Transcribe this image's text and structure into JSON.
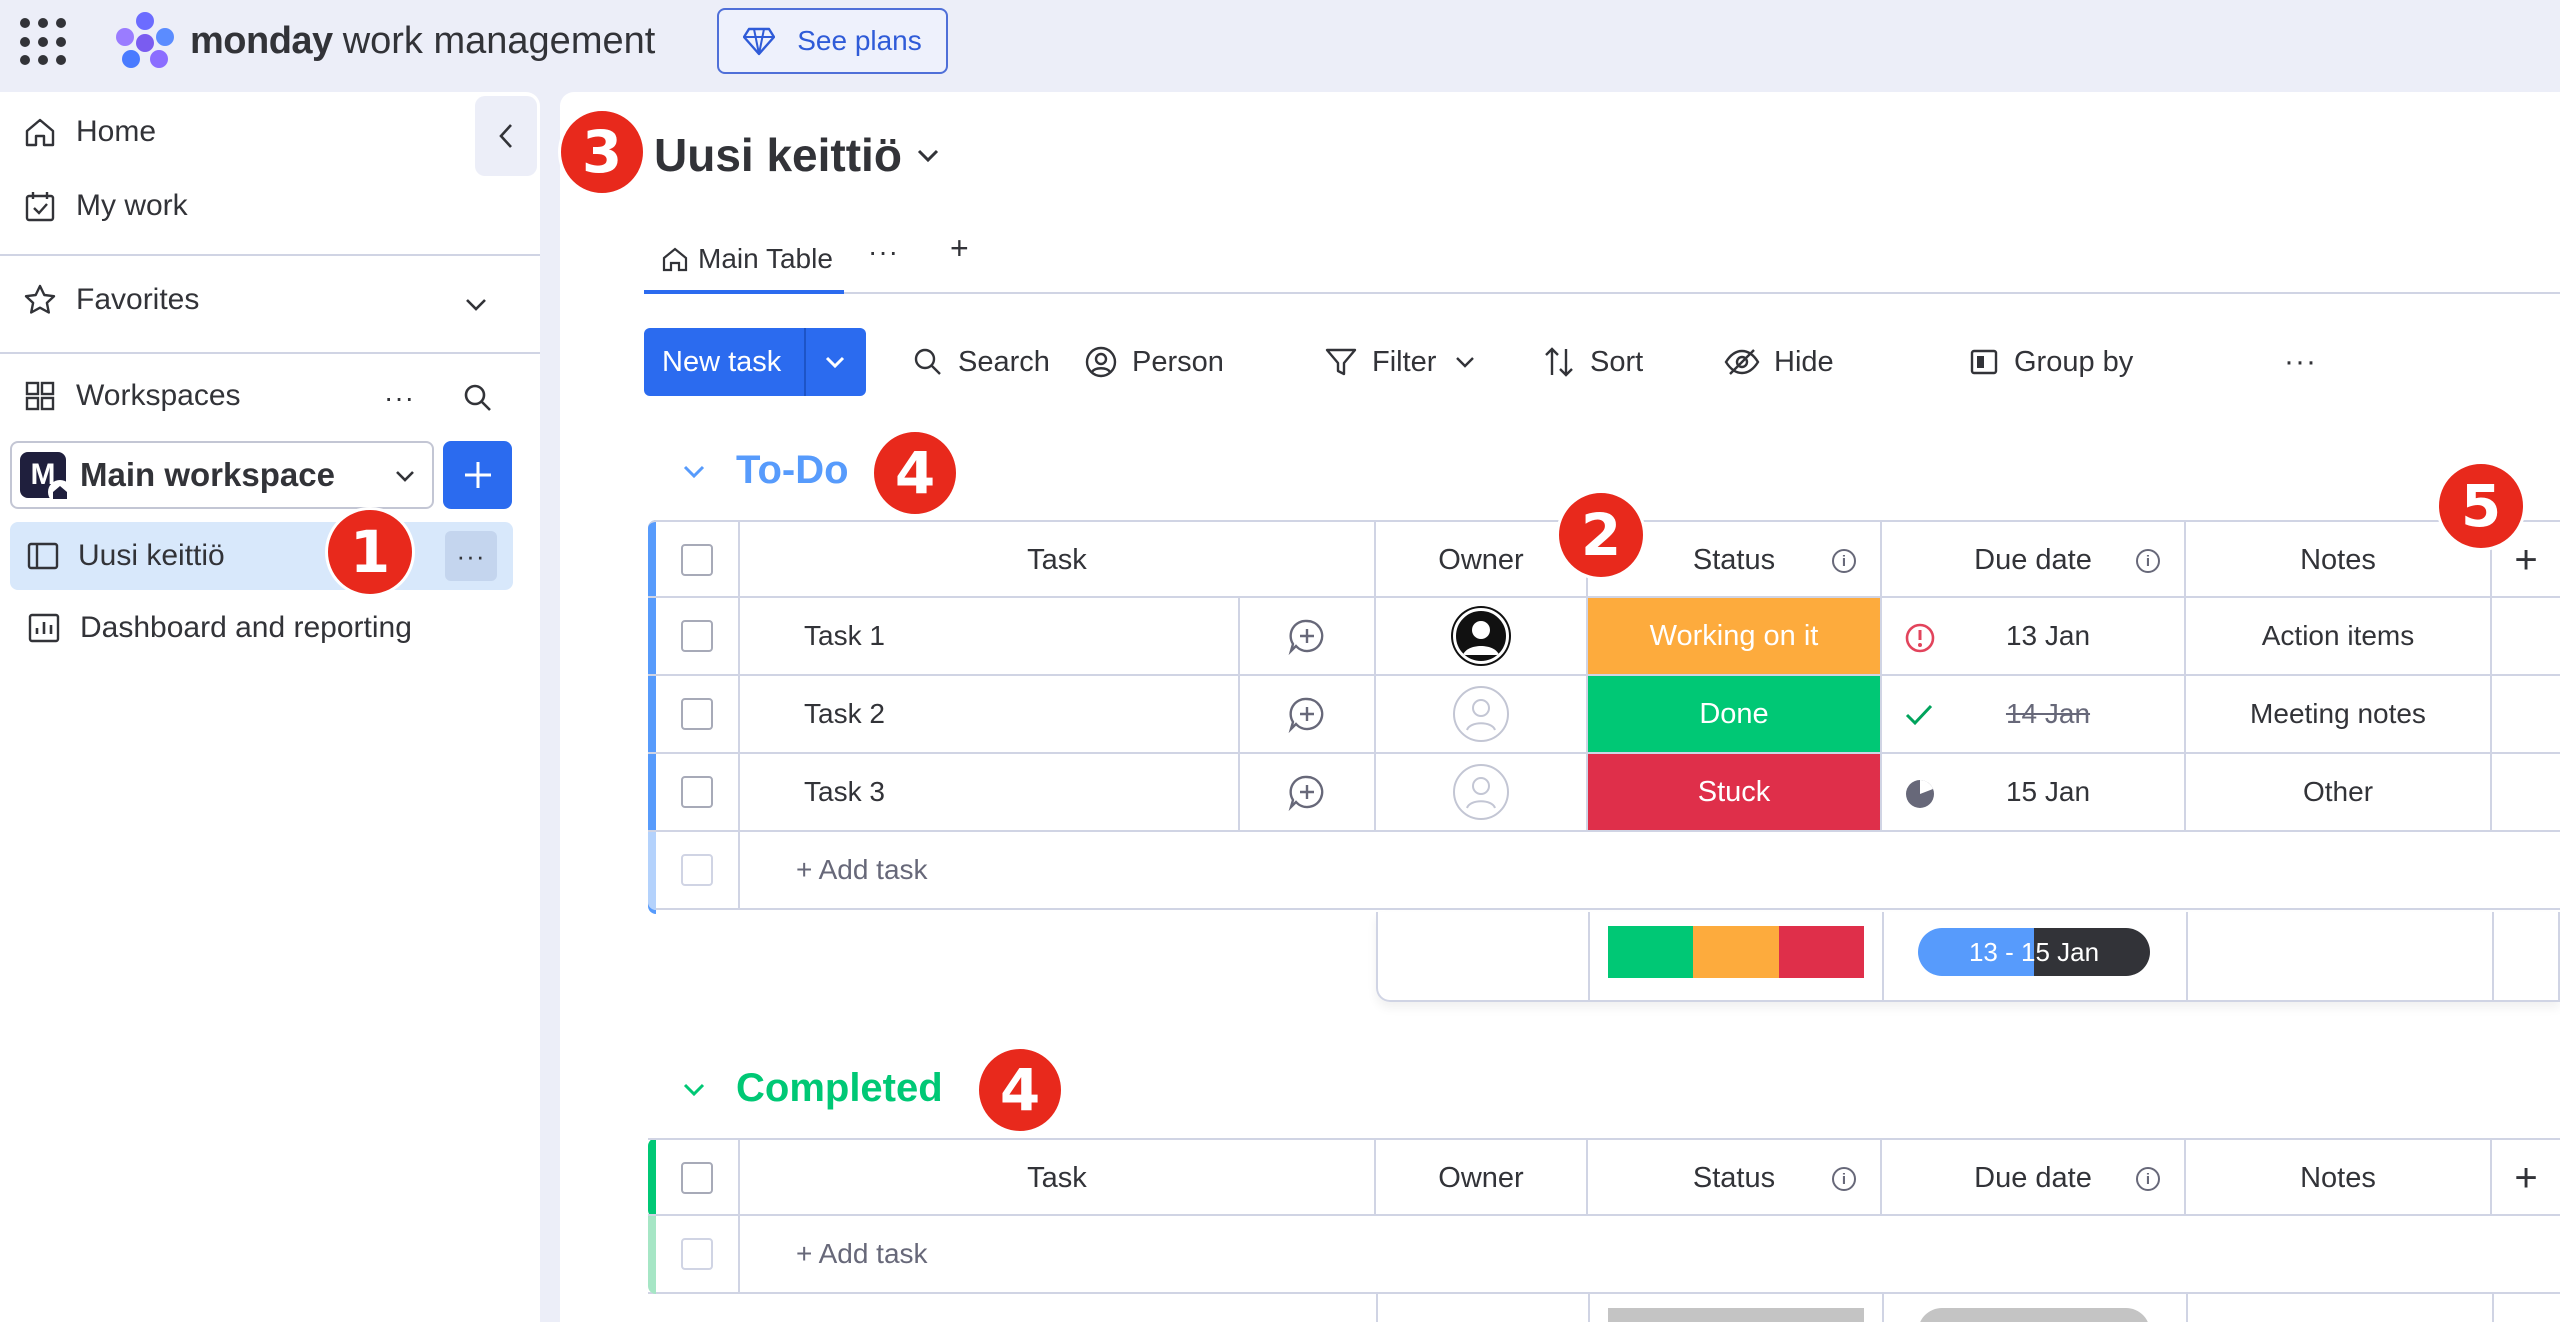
{
  "topbar": {
    "brand": "monday",
    "brand_sub": "work management",
    "see_plans_label": "See plans"
  },
  "sidebar": {
    "home_label": "Home",
    "my_work_label": "My work",
    "favorites_label": "Favorites",
    "workspaces_label": "Workspaces",
    "workspace_initial": "M",
    "workspace_name": "Main workspace",
    "boards": [
      {
        "label": "Uusi keittiö"
      },
      {
        "label": "Dashboard and reporting"
      }
    ]
  },
  "badges": {
    "b1": "1",
    "b2": "2",
    "b3": "3",
    "b4a": "4",
    "b4b": "4",
    "b5": "5"
  },
  "board": {
    "title": "Uusi keittiö",
    "tab_main": "Main Table",
    "tab_more": "···",
    "tab_add": "+"
  },
  "toolbar": {
    "new_task": "New task",
    "search": "Search",
    "person": "Person",
    "filter": "Filter",
    "sort": "Sort",
    "hide": "Hide",
    "group_by": "Group by",
    "more": "···"
  },
  "columns": {
    "task": "Task",
    "owner": "Owner",
    "status": "Status",
    "due_date": "Due date",
    "notes": "Notes",
    "add": "+"
  },
  "groups": {
    "todo": {
      "title": "To-Do",
      "color": "#579bfc",
      "rows": [
        {
          "task": "Task 1",
          "status": "Working on it",
          "status_color": "#fdab3d",
          "due": "13 Jan",
          "notes": "Action items",
          "owner": "filled"
        },
        {
          "task": "Task 2",
          "status": "Done",
          "status_color": "#00c875",
          "due": "14 Jan",
          "notes": "Meeting notes",
          "owner": "empty"
        },
        {
          "task": "Task 3",
          "status": "Stuck",
          "status_color": "#df2f4a",
          "due": "15 Jan",
          "notes": "Other",
          "owner": "empty"
        }
      ],
      "add_task": "+ Add task",
      "timeline": "13 - 15 Jan"
    },
    "completed": {
      "title": "Completed",
      "color": "#00c875",
      "add_task": "+ Add task"
    }
  }
}
